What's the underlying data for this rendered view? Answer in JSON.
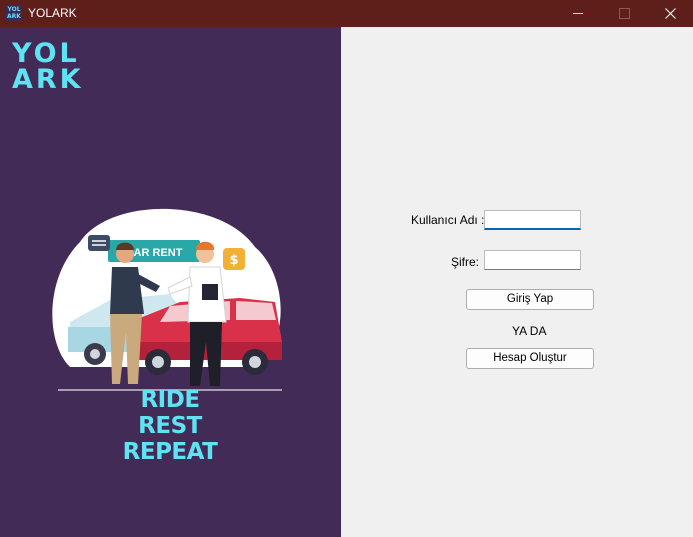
{
  "window": {
    "title": "YOLARK",
    "icon_text_top": "YOL",
    "icon_text_bottom": "ARK"
  },
  "branding": {
    "logo_line1": "YOL",
    "logo_line2": "ARK",
    "illustration_sign": "CAR RENT",
    "illustration_badge": "$",
    "tagline": [
      "RIDE",
      "REST",
      "REPEAT"
    ],
    "panel_color": "#432b57",
    "accent_color": "#5fe3f2"
  },
  "form": {
    "username_label": "Kullanıcı Adı :",
    "username_value": "",
    "password_label": "Şifre:",
    "password_value": "",
    "login_button": "Giriş Yap",
    "or_text": "YA DA",
    "register_button": "Hesap Oluştur"
  }
}
